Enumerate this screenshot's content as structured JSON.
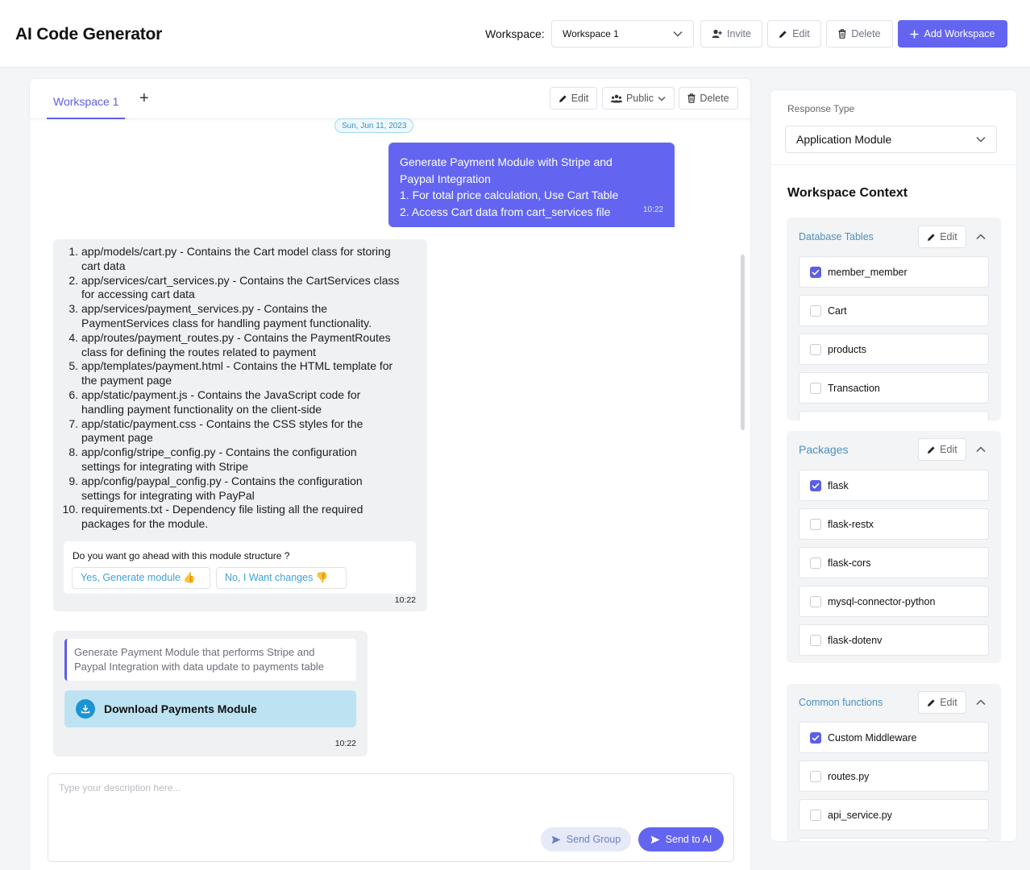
{
  "header": {
    "app_title": "AI Code Generator",
    "workspace_label": "Workspace:",
    "workspace_selected": "Workspace 1",
    "invite_label": "Invite",
    "edit_label": "Edit",
    "delete_label": "Delete",
    "add_workspace_label": "Add Workspace"
  },
  "main": {
    "tabs": [
      {
        "label": "Workspace 1",
        "active": true
      }
    ],
    "add_tab_label": "+",
    "toolbar": {
      "edit_label": "Edit",
      "visibility_label": "Public",
      "delete_label": "Delete"
    },
    "date_separator": "Sun, Jun 11, 2023",
    "user_message": {
      "lines": [
        "Generate Payment Module with Stripe and",
        "Paypal Integration",
        "1. For total price calculation, Use Cart Table",
        "2. Access Cart data from cart_services file"
      ],
      "time": "10:22"
    },
    "ai_message": {
      "items": [
        {
          "num": "1.",
          "lines": [
            "app/models/cart.py - Contains the Cart model class for storing",
            "cart data"
          ]
        },
        {
          "num": "2.",
          "lines": [
            "app/services/cart_services.py - Contains the CartServices class",
            "for accessing cart data"
          ]
        },
        {
          "num": "3.",
          "lines": [
            "app/services/payment_services.py - Contains the",
            "PaymentServices class for handling payment functionality."
          ]
        },
        {
          "num": "4.",
          "lines": [
            "app/routes/payment_routes.py - Contains the PaymentRoutes",
            "class for defining the routes related to payment"
          ]
        },
        {
          "num": "5.",
          "lines": [
            "app/templates/payment.html - Contains the HTML template for",
            "the payment page"
          ]
        },
        {
          "num": "6.",
          "lines": [
            "app/static/payment.js - Contains the JavaScript code for",
            "handling payment functionality on the client-side"
          ]
        },
        {
          "num": "7.",
          "lines": [
            "app/static/payment.css - Contains the CSS styles for the",
            "payment page"
          ]
        },
        {
          "num": "8.",
          "lines": [
            "app/config/stripe_config.py - Contains the configuration",
            "settings for integrating with Stripe"
          ]
        },
        {
          "num": "9.",
          "lines": [
            "app/config/paypal_config.py - Contains the configuration",
            "settings for integrating with PayPal"
          ]
        },
        {
          "num": "10.",
          "lines": [
            "requirements.txt - Dependency file listing all the required",
            "packages for the module."
          ]
        }
      ],
      "question": "Do you want go ahead with this module structure ?",
      "option_yes": "Yes, Generate module 👍",
      "option_no": "No, I Want changes 👎",
      "time": "10:22"
    },
    "module_message": {
      "description": "Generate Payment Module that performs Stripe and Paypal Integration with data update to payments table",
      "download_label": "Download Payments Module",
      "time": "10:22"
    },
    "composer": {
      "placeholder": "Type your description here...",
      "send_group_label": "Send Group",
      "send_ai_label": "Send to AI"
    }
  },
  "sidebar": {
    "response_type_label": "Response Type",
    "response_type_value": "Application Module",
    "context_title": "Workspace Context",
    "edit_label": "Edit",
    "sections": [
      {
        "title": "Database Tables",
        "items": [
          {
            "label": "member_member",
            "checked": true
          },
          {
            "label": "Cart",
            "checked": false
          },
          {
            "label": "products",
            "checked": false
          },
          {
            "label": "Transaction",
            "checked": false
          }
        ]
      },
      {
        "title": "Packages",
        "items": [
          {
            "label": "flask",
            "checked": true
          },
          {
            "label": "flask-restx",
            "checked": false
          },
          {
            "label": "flask-cors",
            "checked": false
          },
          {
            "label": "mysql-connector-python",
            "checked": false
          },
          {
            "label": "flask-dotenv",
            "checked": false
          }
        ]
      },
      {
        "title": "Common functions",
        "items": [
          {
            "label": "Custom Middleware",
            "checked": true
          },
          {
            "label": "routes.py",
            "checked": false
          },
          {
            "label": "api_service.py",
            "checked": false
          }
        ]
      }
    ]
  },
  "colors": {
    "accent": "#6365f1",
    "link": "#4d8fbf",
    "download_bg": "#bde3f3"
  },
  "icons": [
    "chevron-down-icon",
    "invite-user-icon",
    "pencil-icon",
    "trash-icon",
    "plus-icon",
    "people-icon",
    "download-icon",
    "send-icon",
    "chevron-up-icon",
    "checkbox-check-icon"
  ]
}
